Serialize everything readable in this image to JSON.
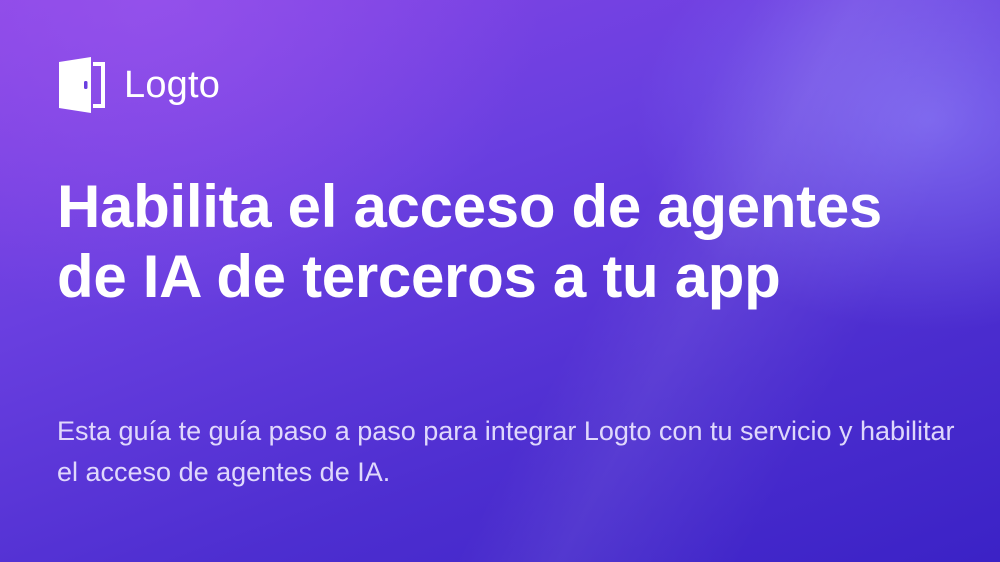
{
  "brand": {
    "name": "Logto",
    "logo_icon": "door-icon"
  },
  "hero": {
    "title": "Habilita el acceso de agentes de IA de terceros a tu app",
    "subtitle": "Esta guía te guía paso a paso para integrar Logto con tu servicio y habilitar el acceso de agentes de IA."
  },
  "colors": {
    "background_top": "#8a46e6",
    "background_bottom": "#3b22c6",
    "text": "#ffffff",
    "subtitle_text": "#ece6ff"
  }
}
